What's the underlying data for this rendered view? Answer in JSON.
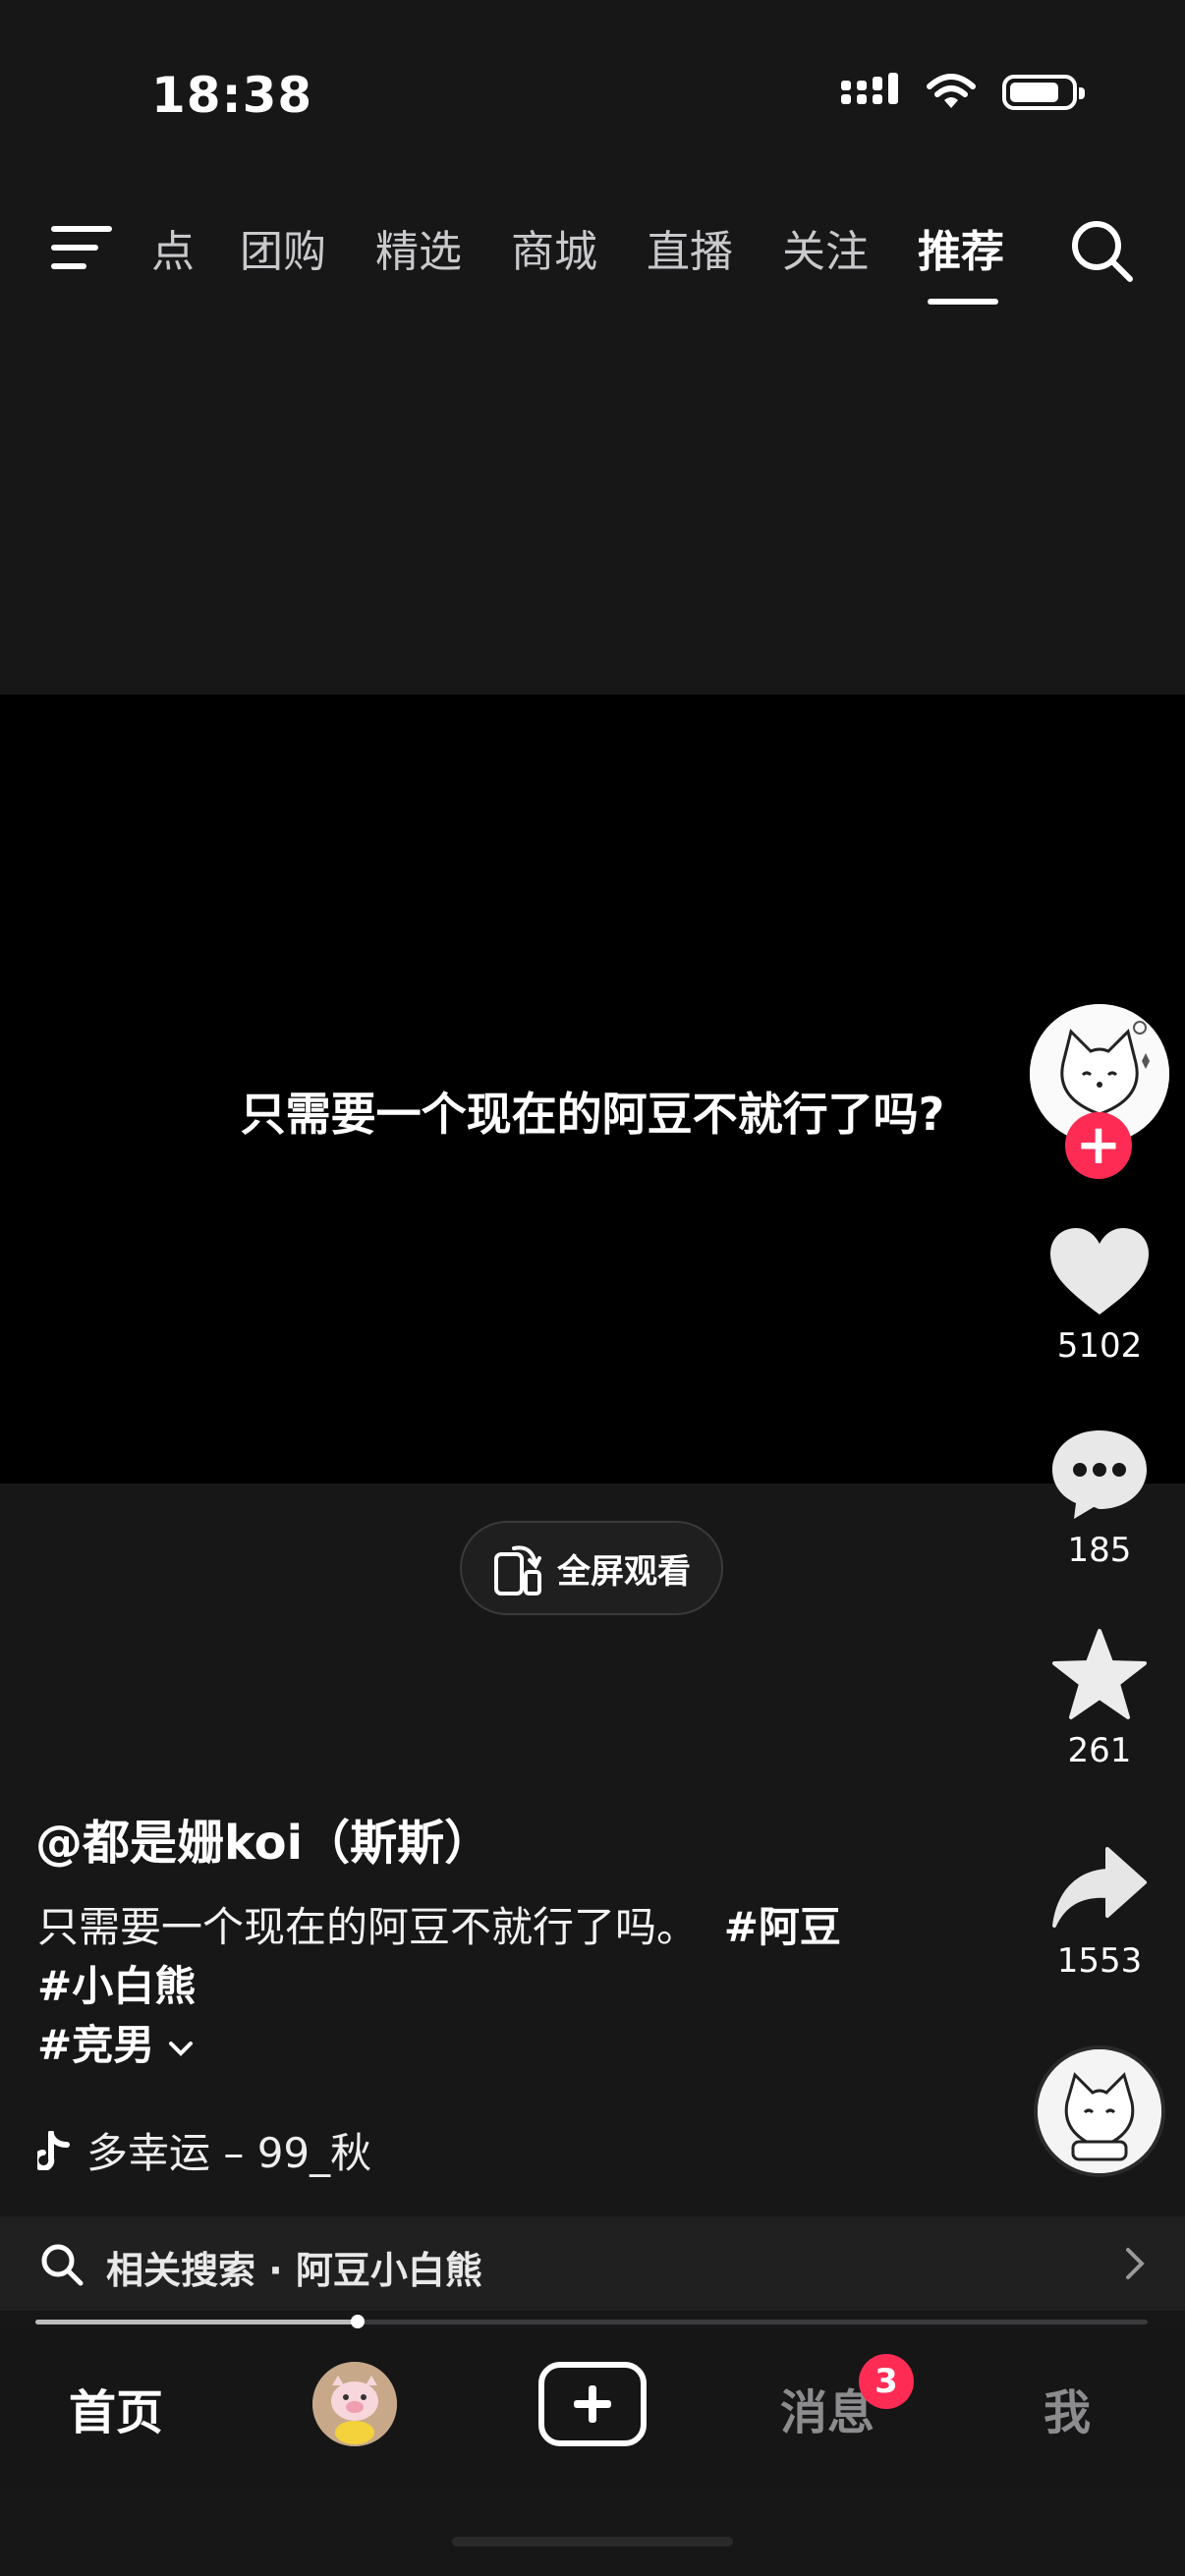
{
  "status_bar": {
    "time": "18:38",
    "battery_level": 0.84
  },
  "top_nav": {
    "tabs": [
      {
        "label": "点"
      },
      {
        "label": "团购"
      },
      {
        "label": "精选"
      },
      {
        "label": "商城"
      },
      {
        "label": "直播"
      },
      {
        "label": "关注"
      },
      {
        "label": "推荐",
        "active": true
      }
    ]
  },
  "video": {
    "caption": "只需要一个现在的阿豆不就行了吗?",
    "fullscreen_label": "全屏观看"
  },
  "rail": {
    "likes": "5102",
    "comments": "185",
    "favorites": "261",
    "shares": "1553"
  },
  "post": {
    "author": "@都是姗koi（斯斯）",
    "description": "只需要一个现在的阿豆不就行了吗。",
    "tags": [
      "#阿豆",
      "#小白熊",
      "#竞男"
    ],
    "music": "多幸运 – 99_秋"
  },
  "related_search": {
    "label": "相关搜索 · 阿豆小白熊"
  },
  "playback": {
    "progress": 0.29
  },
  "bottom_nav": {
    "home": "首页",
    "messages": "消息",
    "messages_badge": "3",
    "me": "我"
  },
  "colors": {
    "accent": "#fe2c55",
    "background": "#171718",
    "video_bg": "#000000"
  }
}
